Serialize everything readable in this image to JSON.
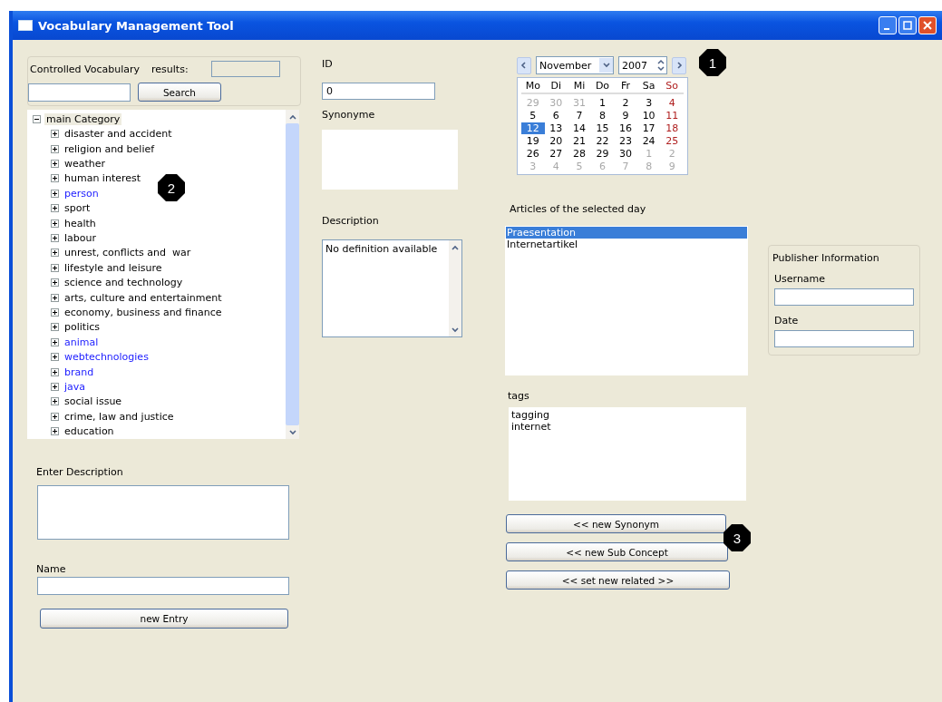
{
  "window": {
    "title": "Vocabulary Management Tool"
  },
  "search_group": {
    "label": "Controlled Vocabulary",
    "results_label": "results:",
    "button": "Search"
  },
  "tree": {
    "label": "main Category",
    "expanded": true,
    "children": [
      {
        "label": "disaster and accident",
        "expanded": false,
        "user_defined": false
      },
      {
        "label": "religion and belief",
        "expanded": false,
        "user_defined": false
      },
      {
        "label": "weather",
        "expanded": false,
        "user_defined": false
      },
      {
        "label": "human interest",
        "expanded": false,
        "user_defined": false
      },
      {
        "label": "person",
        "expanded": false,
        "user_defined": true
      },
      {
        "label": "sport",
        "expanded": false,
        "user_defined": false
      },
      {
        "label": "health",
        "expanded": false,
        "user_defined": false
      },
      {
        "label": "labour",
        "expanded": false,
        "user_defined": false
      },
      {
        "label": "unrest, conflicts and  war",
        "expanded": false,
        "user_defined": false
      },
      {
        "label": "lifestyle and leisure",
        "expanded": false,
        "user_defined": false
      },
      {
        "label": "science and technology",
        "expanded": false,
        "user_defined": false
      },
      {
        "label": "arts, culture and entertainment",
        "expanded": false,
        "user_defined": false
      },
      {
        "label": "economy, business and finance",
        "expanded": false,
        "user_defined": false
      },
      {
        "label": "politics",
        "expanded": false,
        "user_defined": false
      },
      {
        "label": "animal",
        "expanded": false,
        "user_defined": true
      },
      {
        "label": "webtechnologies",
        "expanded": false,
        "user_defined": true
      },
      {
        "label": "brand",
        "expanded": false,
        "user_defined": true
      },
      {
        "label": "java",
        "expanded": false,
        "user_defined": true
      },
      {
        "label": "social issue",
        "expanded": false,
        "user_defined": false
      },
      {
        "label": "crime, law and justice",
        "expanded": false,
        "user_defined": false
      },
      {
        "label": "education",
        "expanded": false,
        "user_defined": false
      }
    ]
  },
  "enter_description": {
    "label": "Enter Description"
  },
  "name": {
    "label": "Name"
  },
  "new_entry_button": "new Entry",
  "id": {
    "label": "ID",
    "value": "0"
  },
  "synonyme": {
    "label": "Synonyme"
  },
  "description": {
    "label": "Description",
    "value": "No definition available"
  },
  "calendar": {
    "month": "November",
    "year": "2007",
    "weekdays": [
      "Mo",
      "Di",
      "Mi",
      "Do",
      "Fr",
      "Sa",
      "So"
    ],
    "weeks": [
      [
        {
          "day": "29",
          "muted": true,
          "selected": false
        },
        {
          "day": "30",
          "muted": true,
          "selected": false
        },
        {
          "day": "31",
          "muted": true,
          "selected": false
        },
        {
          "day": "1",
          "muted": false,
          "selected": false
        },
        {
          "day": "2",
          "muted": false,
          "selected": false
        },
        {
          "day": "3",
          "muted": false,
          "selected": false
        },
        {
          "day": "4",
          "muted": false,
          "selected": false
        }
      ],
      [
        {
          "day": "5",
          "muted": false,
          "selected": false
        },
        {
          "day": "6",
          "muted": false,
          "selected": false
        },
        {
          "day": "7",
          "muted": false,
          "selected": false
        },
        {
          "day": "8",
          "muted": false,
          "selected": false
        },
        {
          "day": "9",
          "muted": false,
          "selected": false
        },
        {
          "day": "10",
          "muted": false,
          "selected": false
        },
        {
          "day": "11",
          "muted": false,
          "selected": false
        }
      ],
      [
        {
          "day": "12",
          "muted": false,
          "selected": true
        },
        {
          "day": "13",
          "muted": false,
          "selected": false
        },
        {
          "day": "14",
          "muted": false,
          "selected": false
        },
        {
          "day": "15",
          "muted": false,
          "selected": false
        },
        {
          "day": "16",
          "muted": false,
          "selected": false
        },
        {
          "day": "17",
          "muted": false,
          "selected": false
        },
        {
          "day": "18",
          "muted": false,
          "selected": false
        }
      ],
      [
        {
          "day": "19",
          "muted": false,
          "selected": false
        },
        {
          "day": "20",
          "muted": false,
          "selected": false
        },
        {
          "day": "21",
          "muted": false,
          "selected": false
        },
        {
          "day": "22",
          "muted": false,
          "selected": false
        },
        {
          "day": "23",
          "muted": false,
          "selected": false
        },
        {
          "day": "24",
          "muted": false,
          "selected": false
        },
        {
          "day": "25",
          "muted": false,
          "selected": false
        }
      ],
      [
        {
          "day": "26",
          "muted": false,
          "selected": false
        },
        {
          "day": "27",
          "muted": false,
          "selected": false
        },
        {
          "day": "28",
          "muted": false,
          "selected": false
        },
        {
          "day": "29",
          "muted": false,
          "selected": false
        },
        {
          "day": "30",
          "muted": false,
          "selected": false
        },
        {
          "day": "1",
          "muted": true,
          "selected": false
        },
        {
          "day": "2",
          "muted": true,
          "selected": false
        }
      ],
      [
        {
          "day": "3",
          "muted": true,
          "selected": false
        },
        {
          "day": "4",
          "muted": true,
          "selected": false
        },
        {
          "day": "5",
          "muted": true,
          "selected": false
        },
        {
          "day": "6",
          "muted": true,
          "selected": false
        },
        {
          "day": "7",
          "muted": true,
          "selected": false
        },
        {
          "day": "8",
          "muted": true,
          "selected": false
        },
        {
          "day": "9",
          "muted": true,
          "selected": false
        }
      ]
    ]
  },
  "articles": {
    "label": "Articles of the selected day",
    "items": [
      {
        "label": "Praesentation",
        "selected": true
      },
      {
        "label": "Internetartikel",
        "selected": false
      }
    ]
  },
  "tags": {
    "label": "tags",
    "items": [
      "tagging",
      "internet"
    ]
  },
  "action_buttons": [
    "<< new Synonym",
    "<< new Sub Concept",
    "<< set new related >>"
  ],
  "publisher": {
    "title": "Publisher Information",
    "fields": [
      {
        "label": "Username"
      },
      {
        "label": "Date"
      }
    ]
  },
  "callouts": [
    "1",
    "2",
    "3"
  ]
}
